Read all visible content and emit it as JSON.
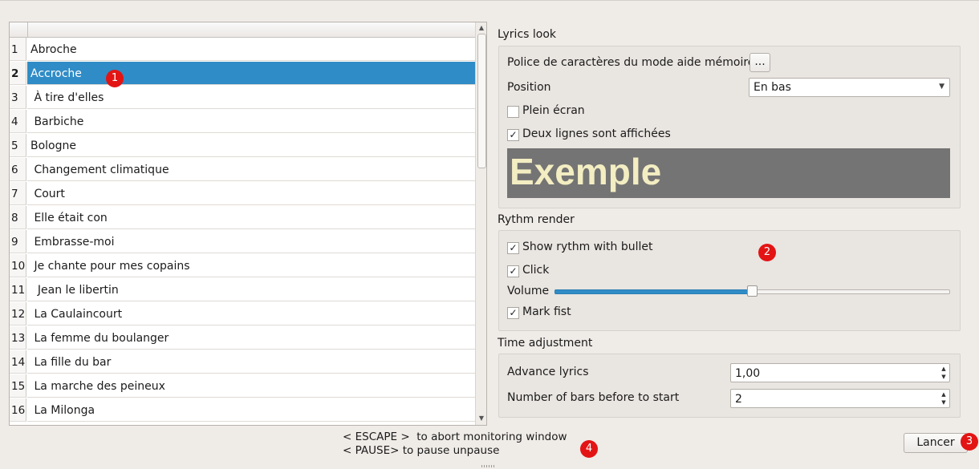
{
  "songs": [
    {
      "num": "1",
      "title": "Abroche"
    },
    {
      "num": "2",
      "title": "Accroche"
    },
    {
      "num": "3",
      "title": " À tire d'elles"
    },
    {
      "num": "4",
      "title": " Barbiche"
    },
    {
      "num": "5",
      "title": "Bologne"
    },
    {
      "num": "6",
      "title": " Changement climatique"
    },
    {
      "num": "7",
      "title": " Court"
    },
    {
      "num": "8",
      "title": " Elle était con"
    },
    {
      "num": "9",
      "title": " Embrasse-moi"
    },
    {
      "num": "10",
      "title": " Je chante pour mes copains"
    },
    {
      "num": "11",
      "title": "  Jean le libertin"
    },
    {
      "num": "12",
      "title": " La Caulaincourt"
    },
    {
      "num": "13",
      "title": " La femme du boulanger"
    },
    {
      "num": "14",
      "title": " La fille du bar"
    },
    {
      "num": "15",
      "title": " La marche des peineux"
    },
    {
      "num": "16",
      "title": " La Milonga"
    }
  ],
  "selected_song_index": 2,
  "lyrics_look": {
    "title": "Lyrics look",
    "font_label": "Police de caractères du mode aide mémoire",
    "font_button": "...",
    "position_label": "Position",
    "position_value": "En bas",
    "fullscreen_label": "Plein écran",
    "fullscreen_checked": false,
    "two_lines_label": "Deux lignes sont affichées",
    "two_lines_checked": true,
    "preview_text": "Exemple",
    "preview_bg": "#747474",
    "preview_fg": "#f3edc2"
  },
  "rhythm_render": {
    "title": "Rythm render",
    "show_bullet_label": "Show rythm with bullet",
    "show_bullet_checked": true,
    "click_label": "Click",
    "click_checked": true,
    "volume_label": "Volume",
    "volume_fraction": 0.5,
    "mark_fist_label": "Mark fist",
    "mark_fist_checked": true
  },
  "time_adjustment": {
    "title": "Time adjustment",
    "advance_label": "Advance lyrics",
    "advance_value": "1,00",
    "bars_label": "Number of bars before to start",
    "bars_value": "2"
  },
  "hints": {
    "line1": "< ESCAPE >  to abort monitoring window",
    "line2": "< PAUSE> to pause unpause"
  },
  "launch_button": "Lancer",
  "badges": {
    "b1": "1",
    "b2": "2",
    "b3": "3",
    "b4": "4"
  },
  "accent_color": "#308cc6",
  "badge_color": "#e31414",
  "icons": {
    "check": "✓",
    "up": "▲",
    "down": "▼"
  }
}
